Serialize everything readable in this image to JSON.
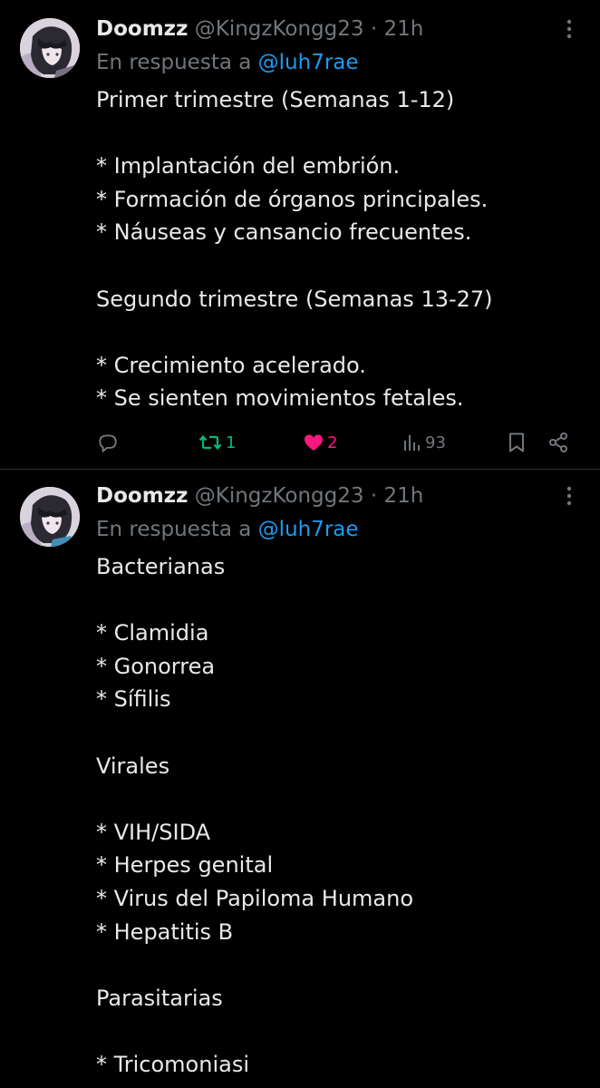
{
  "tweets": [
    {
      "author": {
        "name": "Doomzz",
        "handle": "@KingzKongg23",
        "time_separator": "·",
        "time": "21h"
      },
      "reply_to": {
        "prefix": "En respuesta a",
        "mention": "@luh7rae"
      },
      "text_lines": [
        "Primer trimestre (Semanas 1-12)",
        "",
        "* Implantación del embrión.",
        "* Formación de órganos principales.",
        "* Náuseas y cansancio frecuentes.",
        "",
        "Segundo trimestre (Semanas 13-27)",
        "",
        "* Crecimiento acelerado.",
        "* Se sienten movimientos fetales."
      ],
      "actions": {
        "reply_icon": "speech-bubble",
        "retweet_icon": "retweet-arrows",
        "retweet_count": "1",
        "like_icon": "heart-filled",
        "like_count": "2",
        "views_icon": "bar-chart",
        "views_count": "93",
        "bookmark_icon": "bookmark",
        "share_icon": "share-nodes"
      }
    },
    {
      "author": {
        "name": "Doomzz",
        "handle": "@KingzKongg23",
        "time_separator": "·",
        "time": "21h"
      },
      "reply_to": {
        "prefix": "En respuesta a",
        "mention": "@luh7rae"
      },
      "text_lines": [
        "Bacterianas",
        "",
        "* Clamidia",
        "* Gonorrea",
        "* Sífilis",
        "",
        "Virales",
        "",
        "* VIH/SIDA",
        "* Herpes genital",
        "* Virus del Papiloma Humano",
        "* Hepatitis B",
        "",
        "Parasitarias",
        "",
        "* Tricomoniasi"
      ]
    }
  ],
  "colors": {
    "background": "#000000",
    "text": "#e7e9ea",
    "muted": "#71767b",
    "link": "#1d9bf0",
    "retweet": "#00ba7c",
    "like": "#f91880",
    "divider": "#2f3336"
  }
}
